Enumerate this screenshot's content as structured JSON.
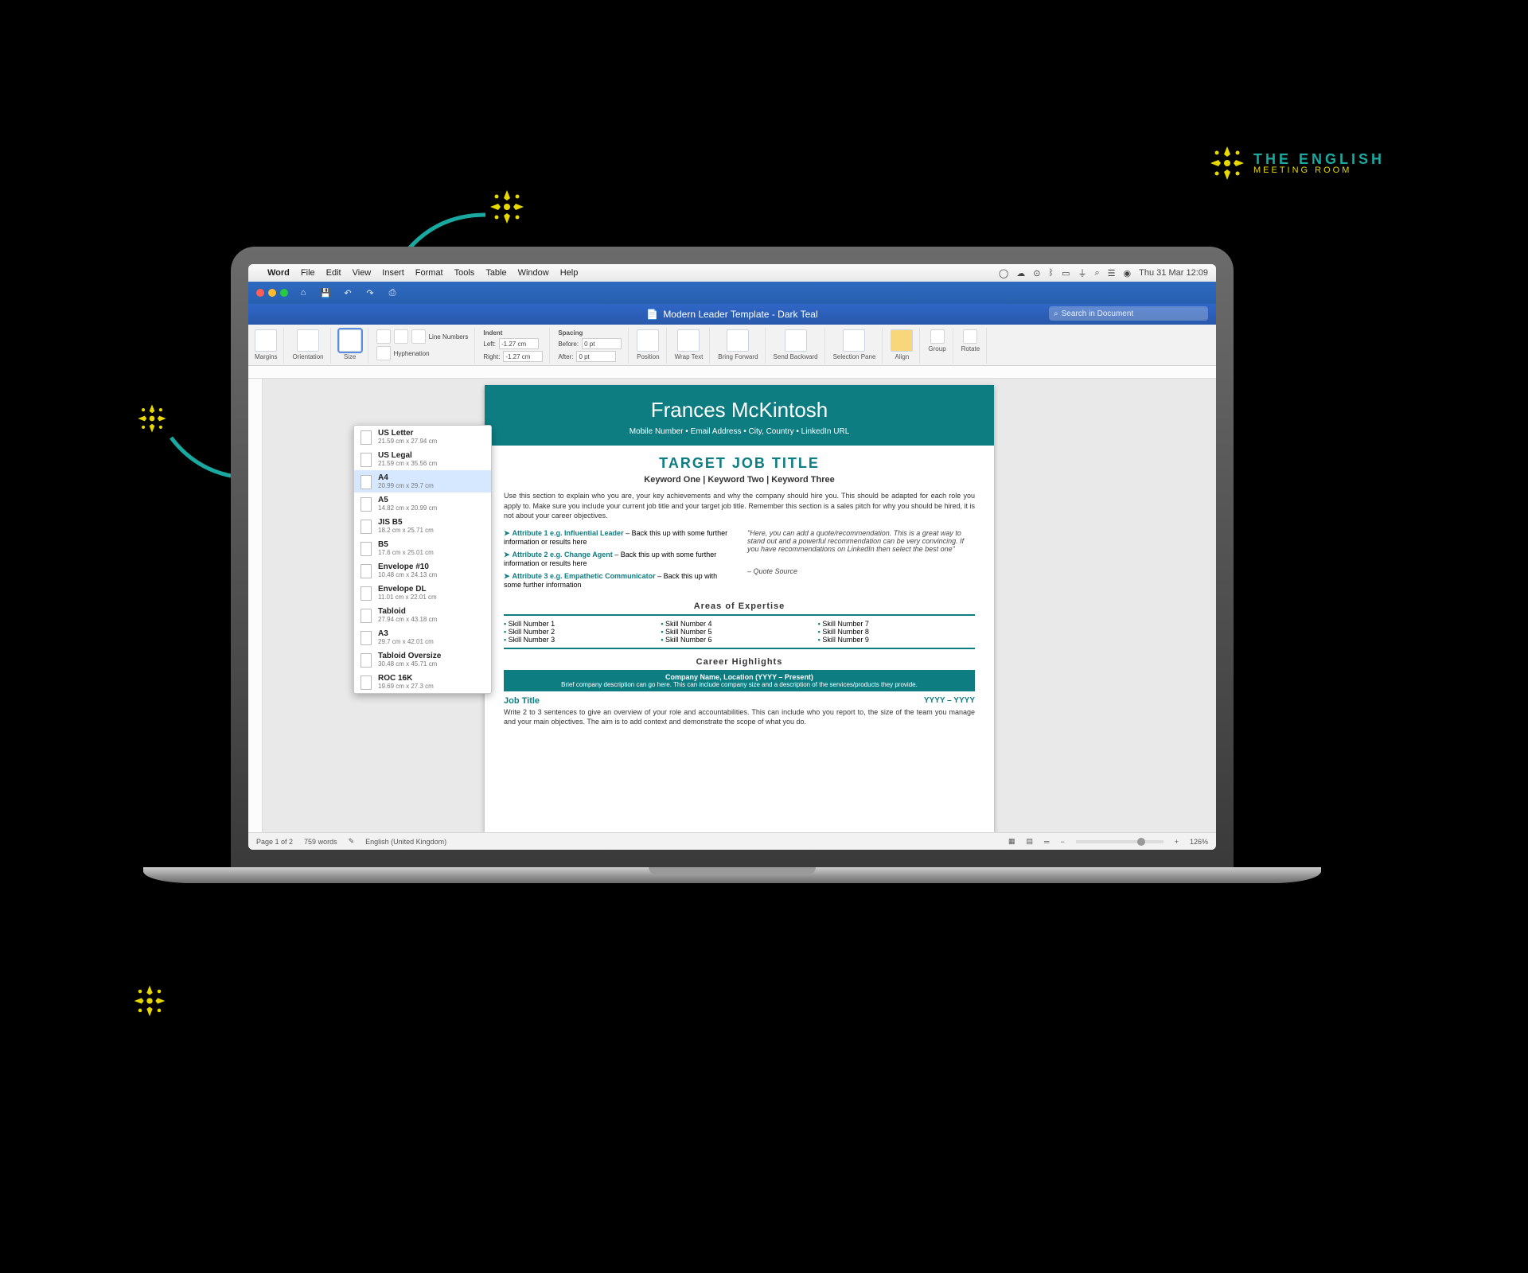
{
  "brand": {
    "top": "THE ENGLISH",
    "bottom": "MEETING ROOM"
  },
  "mac_menu": {
    "app": "Word",
    "items": [
      "File",
      "Edit",
      "View",
      "Insert",
      "Format",
      "Tools",
      "Table",
      "Window",
      "Help"
    ],
    "datetime": "Thu 31 Mar  12:09"
  },
  "titlebar": {
    "title": "Modern Leader Template - Dark Teal"
  },
  "search": {
    "placeholder": "Search in Document"
  },
  "ribbon": {
    "margins": "Margins",
    "orientation": "Orientation",
    "size": "Size",
    "line_numbers": "Line Numbers",
    "hyphenation": "Hyphenation",
    "indent": "Indent",
    "spacing": "Spacing",
    "left_lbl": "Left:",
    "right_lbl": "Right:",
    "before_lbl": "Before:",
    "after_lbl": "After:",
    "left_val": "-1.27 cm",
    "right_val": "-1.27 cm",
    "before_val": "0 pt",
    "after_val": "0 pt",
    "position": "Position",
    "wrap": "Wrap Text",
    "bring": "Bring Forward",
    "send": "Send Backward",
    "selpane": "Selection Pane",
    "align": "Align",
    "group": "Group",
    "rotate": "Rotate"
  },
  "page_sizes": [
    {
      "name": "US Letter",
      "dim": "21.59 cm x 27.94 cm",
      "sel": false
    },
    {
      "name": "US Legal",
      "dim": "21.59 cm x 35.56 cm",
      "sel": false
    },
    {
      "name": "A4",
      "dim": "20.99 cm x 29.7 cm",
      "sel": true
    },
    {
      "name": "A5",
      "dim": "14.82 cm x 20.99 cm",
      "sel": false
    },
    {
      "name": "JIS B5",
      "dim": "18.2 cm x 25.71 cm",
      "sel": false
    },
    {
      "name": "B5",
      "dim": "17.6 cm x 25.01 cm",
      "sel": false
    },
    {
      "name": "Envelope #10",
      "dim": "10.48 cm x 24.13 cm",
      "sel": false
    },
    {
      "name": "Envelope DL",
      "dim": "11.01 cm x 22.01 cm",
      "sel": false
    },
    {
      "name": "Tabloid",
      "dim": "27.94 cm x 43.18 cm",
      "sel": false
    },
    {
      "name": "A3",
      "dim": "29.7 cm x 42.01 cm",
      "sel": false
    },
    {
      "name": "Tabloid Oversize",
      "dim": "30.48 cm x 45.71 cm",
      "sel": false
    },
    {
      "name": "ROC 16K",
      "dim": "19.69 cm x 27.3 cm",
      "sel": false
    }
  ],
  "doc": {
    "name": "Frances McKintosh",
    "contact": "Mobile Number • Email Address • City, Country • LinkedIn URL",
    "target": "TARGET JOB TITLE",
    "keywords": "Keyword One | Keyword Two | Keyword Three",
    "intro": "Use this section to explain who you are, your key achievements and why the company should hire you. This should be adapted for each role you apply to. Make sure you include your current job title and your target job title. Remember this section is a sales pitch for why you should be hired, it is not about your career objectives.",
    "attrs": [
      {
        "label": "Attribute 1 e.g. Influential Leader",
        "tail": " – Back this up with some further information or results here"
      },
      {
        "label": "Attribute 2 e.g. Change Agent",
        "tail": " – Back this up with some further information or results here"
      },
      {
        "label": "Attribute 3 e.g. Empathetic Communicator",
        "tail": " – Back this up with some further information"
      }
    ],
    "quote": "\"Here, you can add a quote/recommendation. This is a great way to stand out and a powerful recommendation can be very convincing. If you have recommendations on LinkedIn then select the best one\"",
    "quote_src": "– Quote Source",
    "areas_hdr": "Areas of Expertise",
    "skills": [
      [
        "Skill Number 1",
        "Skill Number 2",
        "Skill Number 3"
      ],
      [
        "Skill Number 4",
        "Skill Number 5",
        "Skill Number 6"
      ],
      [
        "Skill Number 7",
        "Skill Number 8",
        "Skill Number 9"
      ]
    ],
    "career_hdr": "Career Highlights",
    "company_bar_1": "Company Name, Location (YYYY – Present)",
    "company_bar_2": "Brief company description can go here. This can include company size and a description of the services/products they provide.",
    "job_title": "Job Title",
    "job_dates": "YYYY – YYYY",
    "job_desc": "Write 2 to 3 sentences to give an overview of your role and accountabilities. This can include who you report to, the size of the team you manage and your main objectives. The aim is to add context and demonstrate the scope of what you do."
  },
  "status": {
    "page": "Page 1 of 2",
    "words": "759 words",
    "lang": "English (United Kingdom)",
    "zoom": "126%"
  }
}
